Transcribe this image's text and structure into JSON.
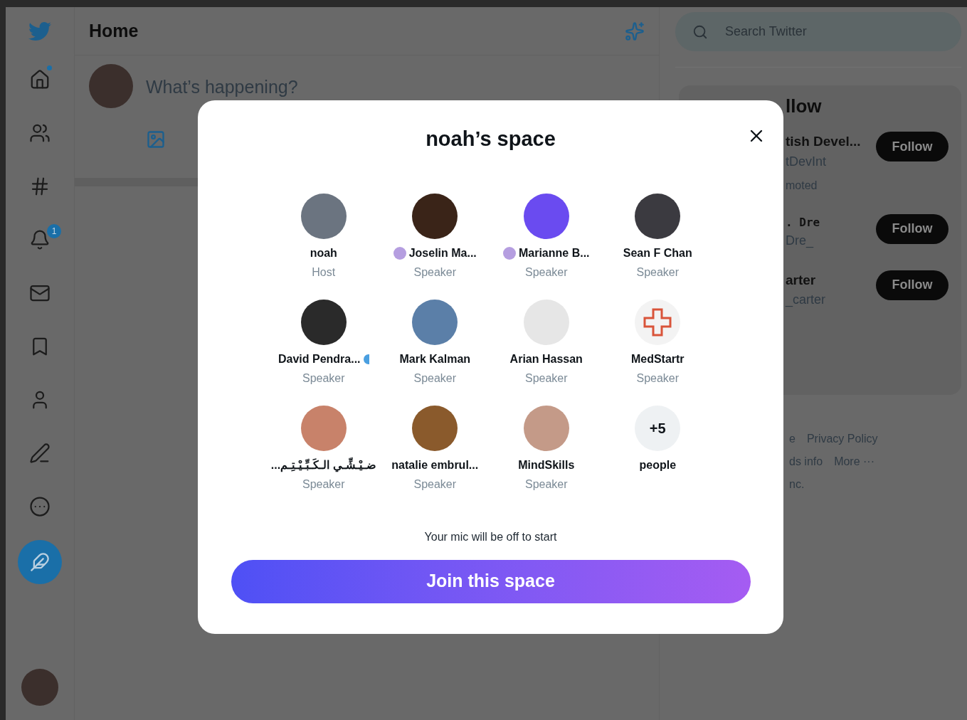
{
  "sidebar": {
    "notification_badge": "1",
    "items": [
      {
        "kind": "home",
        "dot": true
      },
      {
        "kind": "communities",
        "dot": false
      },
      {
        "kind": "hashtag",
        "dot": false
      },
      {
        "kind": "bell",
        "dot": false
      },
      {
        "kind": "mail",
        "dot": false
      },
      {
        "kind": "bookmark",
        "dot": false
      },
      {
        "kind": "person",
        "dot": false
      },
      {
        "kind": "scribble",
        "dot": false
      },
      {
        "kind": "more",
        "dot": false
      }
    ]
  },
  "header": {
    "title": "Home"
  },
  "composer": {
    "placeholder": "What’s happening?"
  },
  "search": {
    "placeholder": "Search Twitter"
  },
  "who_to_follow": {
    "title_visible": "llow",
    "rows": [
      {
        "name": "tish Devel...",
        "handle": "tDevInt",
        "note": "moted",
        "button": "Follow",
        "mono": false
      },
      {
        "name": ". Dre",
        "handle": "Dre_",
        "button": "Follow",
        "mono": true
      },
      {
        "name": "arter",
        "handle": "_carter",
        "button": "Follow",
        "mono": false
      }
    ]
  },
  "footer": [
    [
      "e",
      "Privacy Policy"
    ],
    [
      "ds info",
      "More ···"
    ],
    [
      "nc."
    ]
  ],
  "modal": {
    "title": "noah’s space",
    "participants": [
      {
        "kind": "person",
        "name": "noah",
        "role": "Host",
        "indicator": false,
        "blue_mark": false,
        "color": "#6b7480"
      },
      {
        "kind": "person",
        "name": "Joselin Ma...",
        "role": "Speaker",
        "indicator": true,
        "blue_mark": false,
        "color": "#3a2418"
      },
      {
        "kind": "person",
        "name": "Marianne B...",
        "role": "Speaker",
        "indicator": true,
        "blue_mark": false,
        "color": "#6a4bf0"
      },
      {
        "kind": "person",
        "name": "Sean F Chan",
        "role": "Speaker",
        "indicator": false,
        "blue_mark": false,
        "color": "#3b3a40"
      },
      {
        "kind": "person",
        "name": "David Pendra...",
        "role": "Speaker",
        "indicator": false,
        "blue_mark": true,
        "color": "#2a2a2a"
      },
      {
        "kind": "person",
        "name": "Mark Kalman",
        "role": "Speaker",
        "indicator": false,
        "blue_mark": false,
        "color": "#5b7fa8"
      },
      {
        "kind": "person",
        "name": "Arian Hassan",
        "role": "Speaker",
        "indicator": false,
        "blue_mark": false,
        "color": "#e6e6e6"
      },
      {
        "kind": "logo",
        "name": "MedStartr",
        "role": "Speaker",
        "indicator": false,
        "blue_mark": false,
        "color": "#f3f3f3"
      },
      {
        "kind": "person",
        "name": "...ضـيْـشِّـي الـكَـبِّـيْـتِـم",
        "role": "Speaker",
        "indicator": false,
        "blue_mark": false,
        "color": "#c8826a"
      },
      {
        "kind": "person",
        "name": "natalie embrul...",
        "role": "Speaker",
        "indicator": false,
        "blue_mark": false,
        "color": "#8a5a2c"
      },
      {
        "kind": "person",
        "name": "MindSkills",
        "role": "Speaker",
        "indicator": false,
        "blue_mark": false,
        "color": "#c49a88"
      },
      {
        "kind": "more",
        "count": "+5",
        "name": "people"
      }
    ],
    "note": "Your mic will be off to start",
    "button": "Join this space"
  }
}
